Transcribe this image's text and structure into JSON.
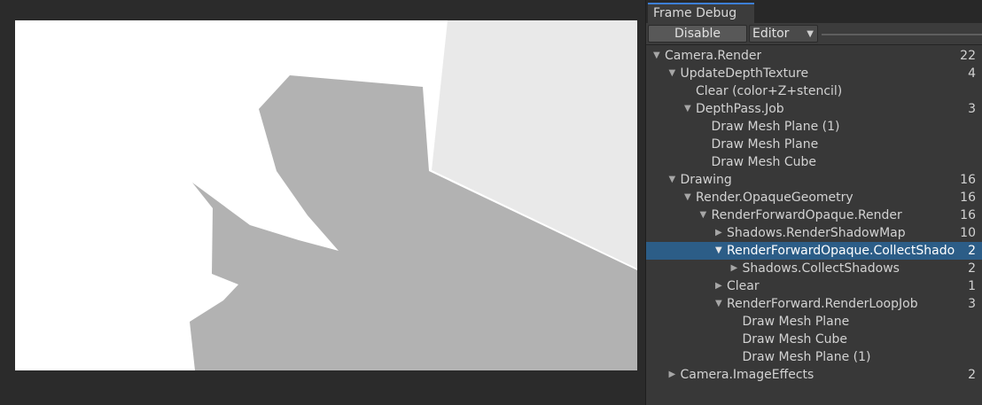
{
  "window": {
    "title": "Frame Debug"
  },
  "toolbar": {
    "disable_label": "Disable",
    "target_value": "Editor"
  },
  "tree": [
    {
      "label": "Camera.Render",
      "count": "22",
      "depth": 0,
      "arrow": "down",
      "selected": false
    },
    {
      "label": "UpdateDepthTexture",
      "count": "4",
      "depth": 1,
      "arrow": "down",
      "selected": false
    },
    {
      "label": "Clear (color+Z+stencil)",
      "count": "",
      "depth": 2,
      "arrow": "none",
      "selected": false
    },
    {
      "label": "DepthPass.Job",
      "count": "3",
      "depth": 2,
      "arrow": "down",
      "selected": false
    },
    {
      "label": "Draw Mesh Plane (1)",
      "count": "",
      "depth": 3,
      "arrow": "none",
      "selected": false
    },
    {
      "label": "Draw Mesh Plane",
      "count": "",
      "depth": 3,
      "arrow": "none",
      "selected": false
    },
    {
      "label": "Draw Mesh Cube",
      "count": "",
      "depth": 3,
      "arrow": "none",
      "selected": false
    },
    {
      "label": "Drawing",
      "count": "16",
      "depth": 1,
      "arrow": "down",
      "selected": false
    },
    {
      "label": "Render.OpaqueGeometry",
      "count": "16",
      "depth": 2,
      "arrow": "down",
      "selected": false
    },
    {
      "label": "RenderForwardOpaque.Render",
      "count": "16",
      "depth": 3,
      "arrow": "down",
      "selected": false
    },
    {
      "label": "Shadows.RenderShadowMap",
      "count": "10",
      "depth": 4,
      "arrow": "right",
      "selected": false
    },
    {
      "label": "RenderForwardOpaque.CollectShado",
      "count": "2",
      "depth": 4,
      "arrow": "down",
      "selected": true
    },
    {
      "label": "Shadows.CollectShadows",
      "count": "2",
      "depth": 5,
      "arrow": "right",
      "selected": false
    },
    {
      "label": "Clear",
      "count": "1",
      "depth": 4,
      "arrow": "right",
      "selected": false
    },
    {
      "label": "RenderForward.RenderLoopJob",
      "count": "3",
      "depth": 4,
      "arrow": "down",
      "selected": false
    },
    {
      "label": "Draw Mesh Plane",
      "count": "",
      "depth": 5,
      "arrow": "none",
      "selected": false
    },
    {
      "label": "Draw Mesh Cube",
      "count": "",
      "depth": 5,
      "arrow": "none",
      "selected": false
    },
    {
      "label": "Draw Mesh Plane (1)",
      "count": "",
      "depth": 5,
      "arrow": "none",
      "selected": false
    },
    {
      "label": "Camera.ImageEffects",
      "count": "2",
      "depth": 1,
      "arrow": "right",
      "selected": false
    }
  ],
  "colors": {
    "selection": "#2c5d87",
    "shadow": "#b2b2b2",
    "wall": "#e9e9e9",
    "panel_bg": "#383838"
  }
}
